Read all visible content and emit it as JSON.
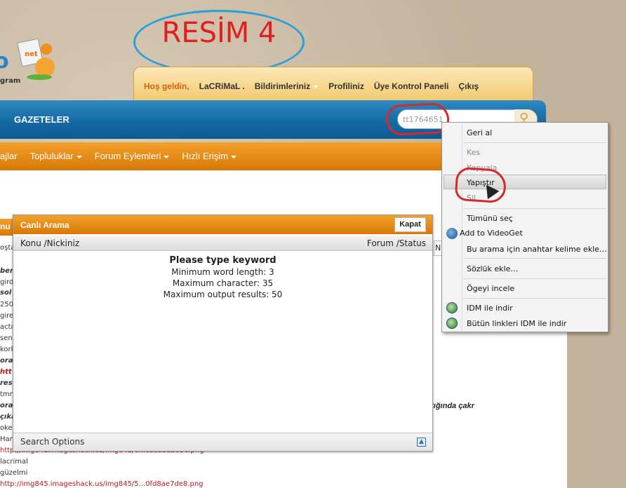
{
  "annotation": {
    "label": "RESİM 4"
  },
  "logo": {
    "letter": "o",
    "subtext": "gram",
    "tag": "net"
  },
  "user_bar": {
    "greeting": "Hoş geldin,",
    "username": "LaCRiMaL .",
    "notifications": "Bildirimleriniz",
    "profile": "Profiliniz",
    "control_panel": "Üye Kontrol Paneli",
    "logout": "Çıkış"
  },
  "header": {
    "section": "GAZETELER",
    "search_value": "tt1764651"
  },
  "orange_nav": {
    "items": [
      "ajlar",
      "Topluluklar",
      "Forum Eylemleri",
      "Hızlı Erişim"
    ]
  },
  "content": {
    "konu_head": "nu (I",
    "lines": [
      {
        "text": "oşta",
        "style": "plain"
      },
      {
        "text": "ber",
        "style": "bold-it"
      },
      {
        "text": "girdi",
        "style": "plain"
      },
      {
        "text": "sol",
        "style": "bold-it"
      },
      {
        "text": "250",
        "style": "plain"
      },
      {
        "text": "gire",
        "style": "plain"
      },
      {
        "text": "actı",
        "style": "plain"
      },
      {
        "text": "sen",
        "style": "plain"
      },
      {
        "text": "kork",
        "style": "plain"
      },
      {
        "text": "ora",
        "style": "bold-it"
      },
      {
        "text": "htt",
        "style": "link-bold"
      },
      {
        "text": "res",
        "style": "bold-it"
      },
      {
        "text": "tmm",
        "style": "plain"
      },
      {
        "text": "ora",
        "style": "bold-it"
      },
      {
        "text": "çıka",
        "style": "bold-it"
      },
      {
        "text": "oke",
        "style": "plain"
      },
      {
        "text": "Han",
        "style": "plain"
      },
      {
        "text": "http://img641.imageshack.us/img641/6...cacdadb03e.png",
        "style": "link"
      },
      {
        "text": "lacrimal",
        "style": "plain"
      },
      {
        "text": "güzelmi",
        "style": "plain"
      },
      {
        "text": "http://img845.imageshack.us/img845/5...0fd8ae7de8.png",
        "style": "link"
      }
    ],
    "right_fragment": "stığında çakr",
    "right_box": "N"
  },
  "live_search": {
    "title": "Canlı Arama",
    "close": "Kapat",
    "col_left": "Konu /Nickiniz",
    "col_right": "Forum /Status",
    "msg_title": "Please type keyword",
    "msg_lines": [
      "Minimum word length: 3",
      "Maximum character: 35",
      "Maximum output results: 50"
    ],
    "footer": "Search Options"
  },
  "context_menu": {
    "items": [
      {
        "label": "Geri al",
        "u": "G",
        "disabled": false
      },
      {
        "label": "Kes",
        "u": "K",
        "disabled": true
      },
      {
        "label": "Kopyala",
        "u": "K",
        "disabled": true
      },
      {
        "label": "Yapıştır",
        "u": "Y",
        "disabled": false,
        "hover": true
      },
      {
        "label": "Sil",
        "u": "S",
        "disabled": true
      },
      {
        "label": "Tümünü seç",
        "u": "T",
        "disabled": false
      },
      {
        "label": "Add to VideoGet",
        "disabled": false
      },
      {
        "label": "Bu arama için anahtar kelime ekle…",
        "disabled": false
      },
      {
        "label": "Sözlük ekle…",
        "disabled": false
      },
      {
        "label": "Ögeyi incele",
        "disabled": false
      },
      {
        "label": "IDM ile indir",
        "disabled": false
      },
      {
        "label": "Bütün linkleri IDM ile indir",
        "disabled": false
      }
    ]
  },
  "colors": {
    "orange": "#d97806",
    "blue": "#146aa5",
    "annotation_red": "#e02020",
    "annotation_blue": "#2aa0d8"
  }
}
